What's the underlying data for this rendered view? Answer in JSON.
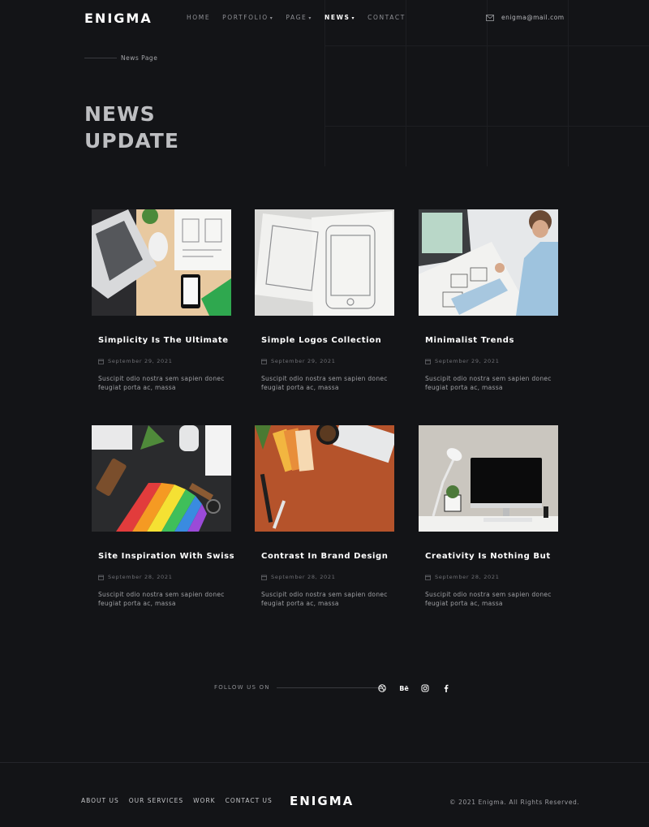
{
  "header": {
    "logo": "ENIGMA",
    "nav": [
      {
        "label": "HOME",
        "caret": ""
      },
      {
        "label": "PORTFOLIO",
        "caret": "▾"
      },
      {
        "label": "PAGE",
        "caret": "▾"
      },
      {
        "label": "NEWS",
        "caret": "▾"
      },
      {
        "label": "CONTACT",
        "caret": ""
      }
    ],
    "active_nav": "NEWS",
    "email": "enigma@mail.com"
  },
  "hero": {
    "breadcrumb": "News Page",
    "title_line1": "NEWS",
    "title_line2": "UPDATE"
  },
  "posts": [
    {
      "title": "Simplicity Is The Ultimate",
      "date": "September 29, 2021",
      "excerpt": "Suscipit odio nostra sem sapien donec feugiat porta ac, massa",
      "image": "laptop-desk-photo"
    },
    {
      "title": "Simple Logos Collection",
      "date": "September 29, 2021",
      "excerpt": "Suscipit odio nostra sem sapien donec feugiat porta ac, massa",
      "image": "wireframe-sketch-photo"
    },
    {
      "title": "Minimalist Trends",
      "date": "September 29, 2021",
      "excerpt": "Suscipit odio nostra sem sapien donec feugiat porta ac, massa",
      "image": "designer-sketching-photo"
    },
    {
      "title": "Site Inspiration With Swiss",
      "date": "September 28, 2021",
      "excerpt": "Suscipit odio nostra sem sapien donec feugiat porta ac, massa",
      "image": "color-swatches-photo"
    },
    {
      "title": "Contrast In Brand Design",
      "date": "September 28, 2021",
      "excerpt": "Suscipit odio nostra sem sapien donec feugiat porta ac, massa",
      "image": "orange-desk-photo"
    },
    {
      "title": "Creativity Is Nothing But",
      "date": "September 28, 2021",
      "excerpt": "Suscipit odio nostra sem sapien donec feugiat porta ac, massa",
      "image": "workspace-lamp-photo"
    }
  ],
  "follow": {
    "label": "FOLLOW US ON",
    "socials": [
      "dribbble-icon",
      "behance-icon",
      "instagram-icon",
      "facebook-icon"
    ],
    "behance_text": "Bē"
  },
  "footer": {
    "links": [
      "ABOUT US",
      "OUR SERVICES",
      "WORK",
      "CONTACT US"
    ],
    "logo": "ENIGMA",
    "copyright": "© 2021 Enigma. All Rights Reserved."
  },
  "colors": {
    "background": "#131417",
    "text_primary": "#ffffff",
    "text_muted": "#8f9095"
  }
}
